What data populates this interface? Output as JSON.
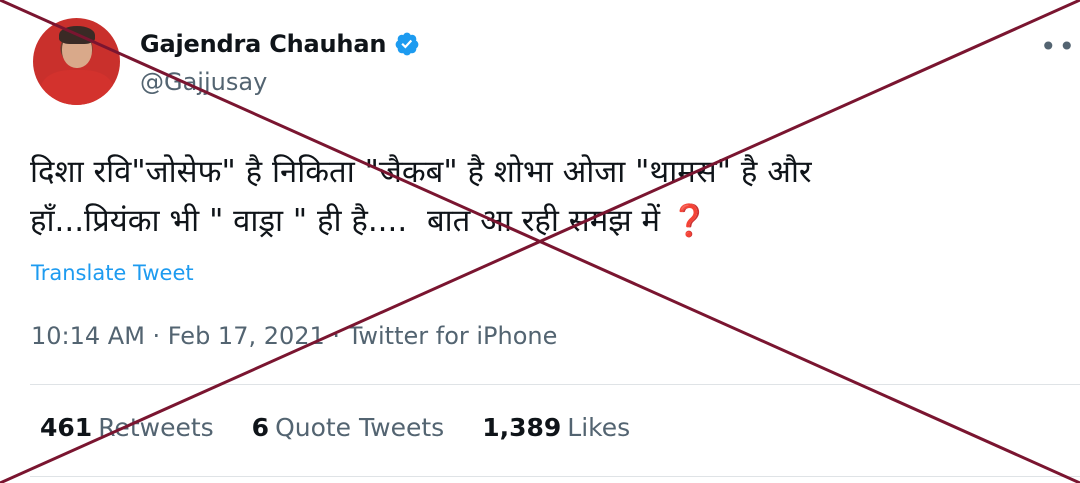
{
  "tweet": {
    "author_name": "Gajendra Chauhan",
    "author_handle": "@Gajjusay",
    "text_line1": "दिशा रवि\"जोसेफ\" है निकिता \"जैकब\" है शोभा ओजा \"थामस\" है और",
    "text_line2": "हाँ...प्रियंका भी \" वाड्रा \" ही है....  बात आ रही समझ में ",
    "question_mark": "❓",
    "translate_label": "Translate Tweet",
    "timestamp": "10:14 AM · Feb 17, 2021 · Twitter for iPhone",
    "stats": {
      "retweets_count": "461",
      "retweets_label": "Retweets",
      "quotes_count": "6",
      "quotes_label": "Quote Tweets",
      "likes_count": "1,389",
      "likes_label": "Likes"
    },
    "more_icon": "more-horizontal-icon"
  },
  "colors": {
    "link": "#1d9bf0",
    "secondary_text": "#536471",
    "cross_stroke": "#7a1530"
  }
}
